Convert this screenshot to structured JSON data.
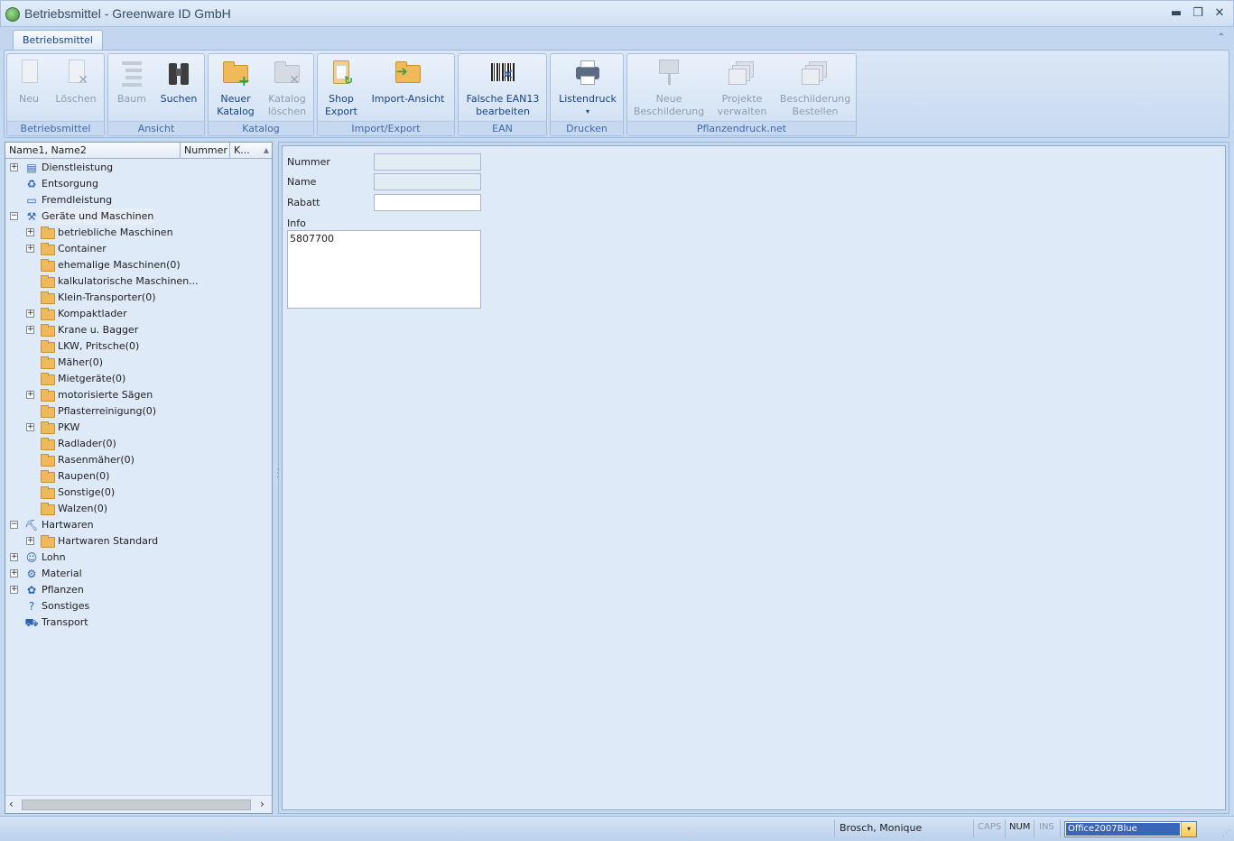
{
  "window": {
    "title": "Betriebsmittel - Greenware ID GmbH",
    "minimize_glyph": "▬",
    "maximize_glyph": "❐",
    "close_glyph": "✕"
  },
  "ribbon": {
    "tab": "Betriebsmittel",
    "collapse_glyph": "⌃",
    "groups": {
      "betriebsmittel": {
        "label": "Betriebsmittel",
        "neu": "Neu",
        "loeschen": "Löschen"
      },
      "ansicht": {
        "label": "Ansicht",
        "baum": "Baum",
        "suchen": "Suchen"
      },
      "katalog": {
        "label": "Katalog",
        "neuer_1": "Neuer",
        "neuer_2": "Katalog",
        "kl_1": "Katalog",
        "kl_2": "löschen"
      },
      "import_export": {
        "label": "Import/Export",
        "shop_1": "Shop",
        "shop_2": "Export",
        "import": "Import-Ansicht"
      },
      "ean": {
        "label": "EAN",
        "falsche_1": "Falsche EAN13",
        "falsche_2": "bearbeiten"
      },
      "drucken": {
        "label": "Drucken",
        "listendruck": "Listendruck",
        "dd_glyph": "▾"
      },
      "pflanzendruck": {
        "label": "Pflanzendruck.net",
        "neue_1": "Neue",
        "neue_2": "Beschilderung",
        "proj_1": "Projekte",
        "proj_2": "verwalten",
        "best_1": "Beschilderung",
        "best_2": "Bestellen"
      }
    }
  },
  "tree": {
    "columns": [
      "Name1, Name2",
      "Nummer",
      "K..."
    ],
    "sort_glyph": "▲",
    "items": [
      {
        "label": "Dienstleistung",
        "level": 0,
        "expander": "+",
        "icon": "▤"
      },
      {
        "label": "Entsorgung",
        "level": 0,
        "expander": "",
        "icon": "♻"
      },
      {
        "label": "Fremdleistung",
        "level": 0,
        "expander": "",
        "icon": "▭"
      },
      {
        "label": "Geräte und Maschinen",
        "level": 0,
        "expander": "−",
        "icon": "⚒"
      },
      {
        "label": "betriebliche Maschinen",
        "level": 1,
        "expander": "+",
        "icon": "folder"
      },
      {
        "label": "Container",
        "level": 1,
        "expander": "+",
        "icon": "folder"
      },
      {
        "label": "ehemalige Maschinen(0)",
        "level": 1,
        "expander": "",
        "icon": "folder"
      },
      {
        "label": "kalkulatorische Maschinen...",
        "level": 1,
        "expander": "",
        "icon": "folder"
      },
      {
        "label": "Klein-Transporter(0)",
        "level": 1,
        "expander": "",
        "icon": "folder"
      },
      {
        "label": "Kompaktlader",
        "level": 1,
        "expander": "+",
        "icon": "folder"
      },
      {
        "label": "Krane u. Bagger",
        "level": 1,
        "expander": "+",
        "icon": "folder"
      },
      {
        "label": "LKW, Pritsche(0)",
        "level": 1,
        "expander": "",
        "icon": "folder"
      },
      {
        "label": "Mäher(0)",
        "level": 1,
        "expander": "",
        "icon": "folder"
      },
      {
        "label": "Mietgeräte(0)",
        "level": 1,
        "expander": "",
        "icon": "folder"
      },
      {
        "label": "motorisierte Sägen",
        "level": 1,
        "expander": "+",
        "icon": "folder"
      },
      {
        "label": "Pflasterreinigung(0)",
        "level": 1,
        "expander": "",
        "icon": "folder"
      },
      {
        "label": "PKW",
        "level": 1,
        "expander": "+",
        "icon": "folder"
      },
      {
        "label": "Radlader(0)",
        "level": 1,
        "expander": "",
        "icon": "folder"
      },
      {
        "label": "Rasenmäher(0)",
        "level": 1,
        "expander": "",
        "icon": "folder"
      },
      {
        "label": "Raupen(0)",
        "level": 1,
        "expander": "",
        "icon": "folder"
      },
      {
        "label": "Sonstige(0)",
        "level": 1,
        "expander": "",
        "icon": "folder"
      },
      {
        "label": "Walzen(0)",
        "level": 1,
        "expander": "",
        "icon": "folder"
      },
      {
        "label": "Hartwaren",
        "level": 0,
        "expander": "−",
        "icon": "⛏"
      },
      {
        "label": "Hartwaren Standard",
        "level": 1,
        "expander": "+",
        "icon": "folder"
      },
      {
        "label": "Lohn",
        "level": 0,
        "expander": "+",
        "icon": "☺"
      },
      {
        "label": "Material",
        "level": 0,
        "expander": "+",
        "icon": "⚙"
      },
      {
        "label": "Pflanzen",
        "level": 0,
        "expander": "+",
        "icon": "✿"
      },
      {
        "label": "Sonstiges",
        "level": 0,
        "expander": "",
        "icon": "?"
      },
      {
        "label": "Transport",
        "level": 0,
        "expander": "",
        "icon": "⛟"
      }
    ],
    "scroll_left": "‹",
    "scroll_right": "›"
  },
  "detail": {
    "nummer_label": "Nummer",
    "nummer_value": "",
    "name_label": "Name",
    "name_value": "",
    "rabatt_label": "Rabatt",
    "rabatt_value": "",
    "info_label": "Info",
    "info_value": "5807700"
  },
  "status": {
    "user": "Brosch, Monique",
    "caps": "CAPS",
    "num": "NUM",
    "ins": "INS",
    "skin": "Office2007Blue",
    "dd_glyph": "▾",
    "grip": "⋰"
  }
}
